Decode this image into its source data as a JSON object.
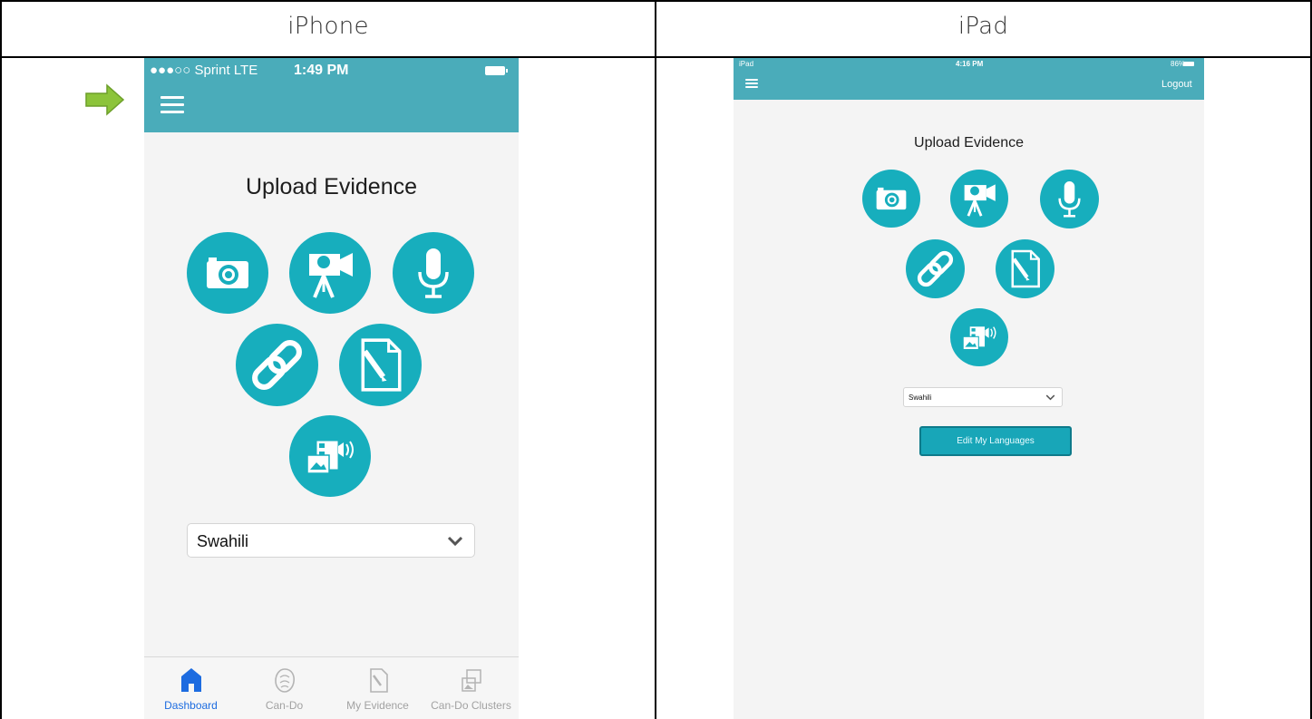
{
  "table": {
    "col1_title": "iPhone",
    "col2_title": "iPad"
  },
  "colors": {
    "header_bar": "#4aacba",
    "icon_circle": "#17aebd",
    "arrow_green": "#8cc43a",
    "active_tab": "#1d6ce0"
  },
  "iphone": {
    "status": {
      "carrier": "●●●○○ Sprint  LTE",
      "time": "1:49 PM"
    },
    "menu_icon": "hamburger-icon",
    "title": "Upload Evidence",
    "upload_buttons": [
      {
        "name": "camera",
        "icon": "camera-icon"
      },
      {
        "name": "video",
        "icon": "video-camera-icon"
      },
      {
        "name": "audio",
        "icon": "microphone-icon"
      },
      {
        "name": "link",
        "icon": "link-icon"
      },
      {
        "name": "document",
        "icon": "document-edit-icon"
      },
      {
        "name": "multimedia",
        "icon": "multimedia-icon"
      }
    ],
    "language_select": {
      "value": "Swahili"
    },
    "tabbar": [
      {
        "label": "Dashboard",
        "icon": "home-icon",
        "active": true
      },
      {
        "label": "Can-Do",
        "icon": "can-do-icon",
        "active": false
      },
      {
        "label": "My Evidence",
        "icon": "evidence-icon",
        "active": false
      },
      {
        "label": "Can-Do Clusters",
        "icon": "clusters-icon",
        "active": false
      }
    ]
  },
  "ipad": {
    "status": {
      "device": "iPad ",
      "time": "4:16 PM",
      "battery": "86%"
    },
    "logout_label": "Logout",
    "title": "Upload Evidence",
    "language_select": {
      "value": "Swahili"
    },
    "edit_languages_label": "Edit My Languages"
  }
}
